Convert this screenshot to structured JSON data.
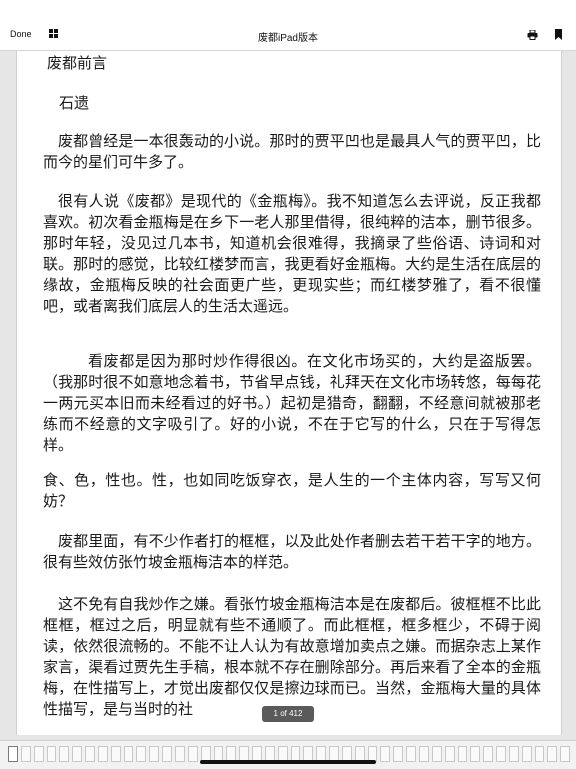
{
  "toolbar": {
    "done_label": "Done",
    "grid_icon": "grid-icon",
    "title": "废都iPad版本",
    "print_icon": "printer-icon",
    "bookmark_icon": "bookmark-icon"
  },
  "document": {
    "heading": "废都前言",
    "author": "石遗",
    "paragraphs": [
      "废都曾经是一本很轰动的小说。那时的贾平凹也是最具人气的贾平凹，比而今的星们可牛多了。",
      "很有人说《废都》是现代的《金瓶梅》。我不知道怎么去评说，反正我都喜欢。初次看金瓶梅是在乡下一老人那里借得，很纯粹的洁本，删节很多。那时年轻，没见过几本书，知道机会很难得，我摘录了些俗语、诗词和对联。那时的感觉，比较红楼梦而言，我更看好金瓶梅。大约是生活在底层的缘故，金瓶梅反映的社会面更广些，更现实些；而红楼梦雅了，看不很懂吧，或者离我们底层人的生活太遥远。",
      "看废都是因为那时炒作得很凶。在文化市场买的，大约是盗版罢。（我那时很不如意地念着书，节省早点钱，礼拜天在文化市场转悠，每每花一两元买本旧而未经看过的好书。）起初是猎奇，翻翻，不经意间就被那老练而不经意的文字吸引了。好的小说，不在于它写的什么，只在于写得怎样。",
      "食、色，性也。性，也如同吃饭穿衣，是人生的一个主体内容，写写又何妨？",
      "废都里面，有不少作者打的框框，以及此处作者删去若干若干字的地方。很有些效仿张竹坡金瓶梅洁本的样范。",
      "这不免有自我炒作之嫌。看张竹坡金瓶梅洁本是在废都后。彼框框不比此框框，框过之后，明显就有些不通顺了。而此框框，框多框少，不碍于阅读，依然很流畅的。不能不让人认为有故意增加卖点之嫌。而据杂志上某作家言，渠看过贾先生手稿，根本就不存在删除部分。再后来看了全本的金瓶梅，在性描写上，才觉出废都仅仅是擦边球而已。当然，金瓶梅大量的具体性描写，是与当时的社"
    ]
  },
  "page_counter": "1 of 412"
}
